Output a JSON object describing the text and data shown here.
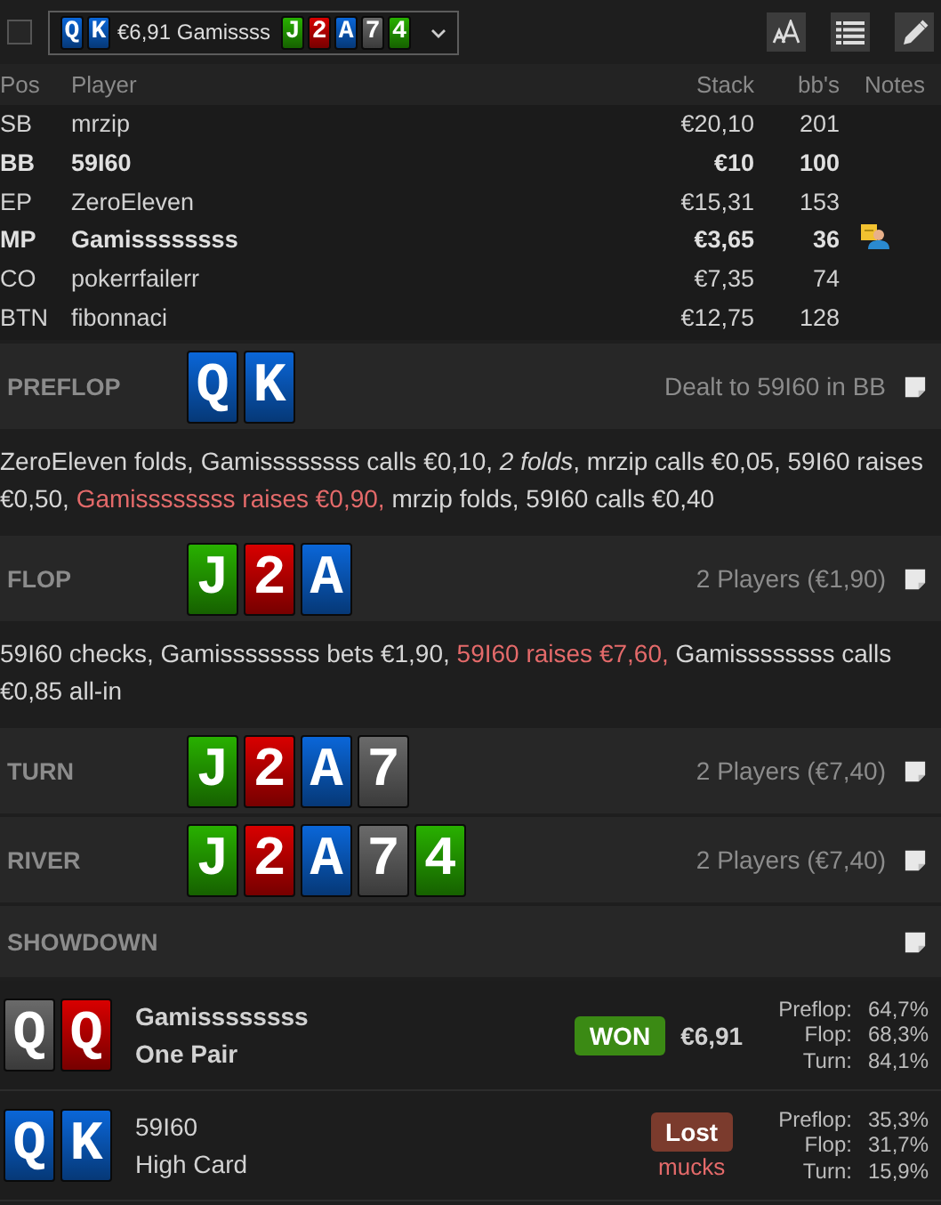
{
  "selector": {
    "checked": false,
    "hero_cards": [
      {
        "rank": "Q",
        "color": "#0a66d8"
      },
      {
        "rank": "K",
        "color": "#0a66d8"
      }
    ],
    "text": "€6,91 Gamissss",
    "board": [
      {
        "rank": "J",
        "color": "#28b000"
      },
      {
        "rank": "2",
        "color": "#d80000"
      },
      {
        "rank": "A",
        "color": "#0a66d8"
      },
      {
        "rank": "7",
        "color": "#6a6a6a"
      },
      {
        "rank": "4",
        "color": "#28b000"
      }
    ]
  },
  "toolbar": [
    {
      "kind": "font"
    },
    {
      "kind": "list"
    },
    {
      "kind": "edit"
    }
  ],
  "columns": [
    "Pos",
    "Player",
    "Stack",
    "bb's",
    "Notes"
  ],
  "players": [
    {
      "pos": "SB",
      "name": "mrzip",
      "stack": "€20,10",
      "bbs": "201",
      "bold": false,
      "has_note": false
    },
    {
      "pos": "BB",
      "name": "59I60",
      "stack": "€10",
      "bbs": "100",
      "bold": true,
      "has_note": false
    },
    {
      "pos": "EP",
      "name": "ZeroEleven",
      "stack": "€15,31",
      "bbs": "153",
      "bold": false,
      "has_note": false
    },
    {
      "pos": "MP",
      "name": "Gamissssssss",
      "stack": "€3,65",
      "bbs": "36",
      "bold": true,
      "has_note": true
    },
    {
      "pos": "CO",
      "name": "pokerrfailerr",
      "stack": "€7,35",
      "bbs": "74",
      "bold": false,
      "has_note": false
    },
    {
      "pos": "BTN",
      "name": "fibonnaci",
      "stack": "€12,75",
      "bbs": "128",
      "bold": false,
      "has_note": false
    }
  ],
  "streets": [
    {
      "name": "PREFLOP",
      "cards": [
        {
          "rank": "Q",
          "color": "#0a66d8"
        },
        {
          "rank": "K",
          "color": "#0a66d8"
        }
      ],
      "info": "Dealt to 59I60 in BB",
      "actions": [
        {
          "kind": "plain",
          "text": "ZeroEleven folds, Gamissssssss calls €0,10, "
        },
        {
          "kind": "summary",
          "text": "2 folds"
        },
        {
          "kind": "plain",
          "text": ", mrzip calls €0,05, 59I60 raises €0,50, "
        },
        {
          "kind": "raise",
          "text": "Gamissssssss raises €0,90,"
        },
        {
          "kind": "plain",
          "text": " mrzip folds, 59I60 calls €0,40"
        }
      ]
    },
    {
      "name": "FLOP",
      "cards": [
        {
          "rank": "J",
          "color": "#28b000"
        },
        {
          "rank": "2",
          "color": "#d80000"
        },
        {
          "rank": "A",
          "color": "#0a66d8"
        }
      ],
      "info": "2 Players (€1,90)",
      "actions": [
        {
          "kind": "plain",
          "text": "59I60 checks, Gamissssssss bets €1,90, "
        },
        {
          "kind": "raise",
          "text": "59I60 raises €7,60,"
        },
        {
          "kind": "plain",
          "text": " Gamissssssss calls €0,85 all-in"
        }
      ]
    },
    {
      "name": "TURN",
      "cards": [
        {
          "rank": "J",
          "color": "#28b000"
        },
        {
          "rank": "2",
          "color": "#d80000"
        },
        {
          "rank": "A",
          "color": "#0a66d8"
        },
        {
          "rank": "7",
          "color": "#6a6a6a"
        }
      ],
      "info": "2 Players (€7,40)"
    },
    {
      "name": "RIVER",
      "cards": [
        {
          "rank": "J",
          "color": "#28b000"
        },
        {
          "rank": "2",
          "color": "#d80000"
        },
        {
          "rank": "A",
          "color": "#0a66d8"
        },
        {
          "rank": "7",
          "color": "#6a6a6a"
        },
        {
          "rank": "4",
          "color": "#28b000"
        }
      ],
      "info": "2 Players (€7,40)"
    },
    {
      "name": "SHOWDOWN"
    }
  ],
  "showdown": [
    {
      "cards": [
        {
          "rank": "Q",
          "color": "#6a6a6a"
        },
        {
          "rank": "Q",
          "color": "#d80000"
        }
      ],
      "player": "Gamissssssss",
      "hand": "One Pair",
      "bold": true,
      "result": {
        "kind": "won",
        "label": "WON",
        "amount": "€6,91"
      },
      "equity": [
        {
          "label": "Preflop:",
          "value": "64,7%"
        },
        {
          "label": "Flop:",
          "value": "68,3%"
        },
        {
          "label": "Turn:",
          "value": "84,1%"
        }
      ]
    },
    {
      "cards": [
        {
          "rank": "Q",
          "color": "#0a66d8"
        },
        {
          "rank": "K",
          "color": "#0a66d8"
        }
      ],
      "player": "59I60",
      "hand": "High Card",
      "bold": false,
      "result": {
        "kind": "lost",
        "label": "Lost",
        "note": "mucks"
      },
      "equity": [
        {
          "label": "Preflop:",
          "value": "35,3%"
        },
        {
          "label": "Flop:",
          "value": "31,7%"
        },
        {
          "label": "Turn:",
          "value": "15,9%"
        }
      ]
    }
  ]
}
